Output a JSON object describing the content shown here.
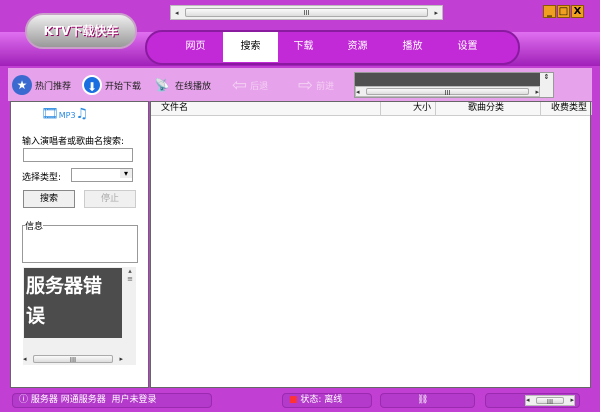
{
  "logo": "KTV下载快车",
  "window_controls": {
    "minimize": "_",
    "maximize": "□",
    "close": "X"
  },
  "nav_tabs": [
    {
      "label": "网页"
    },
    {
      "label": "搜索",
      "active": true
    },
    {
      "label": "下载"
    },
    {
      "label": "资源"
    },
    {
      "label": "播放"
    },
    {
      "label": "设置"
    }
  ],
  "toolbar": {
    "hot": "热门推荐",
    "download": "开始下载",
    "online": "在线播放",
    "back": "后退",
    "forward": "前进"
  },
  "left": {
    "search_label": "输入演唱者或歌曲名搜索:",
    "search_value": "",
    "type_label": "选择类型:",
    "type_value": "",
    "search_btn": "搜索",
    "stop_btn": "停止",
    "info_label": "信息",
    "error_text": "服务器错误",
    "mp3": "MP3"
  },
  "table": {
    "columns": [
      "文件名",
      "大小",
      "歌曲分类",
      "收费类型"
    ],
    "rows": []
  },
  "scroll_mark": "III",
  "status": {
    "server": "服务器 网通服务器",
    "user": "用户未登录",
    "state": "状态: 离线"
  }
}
